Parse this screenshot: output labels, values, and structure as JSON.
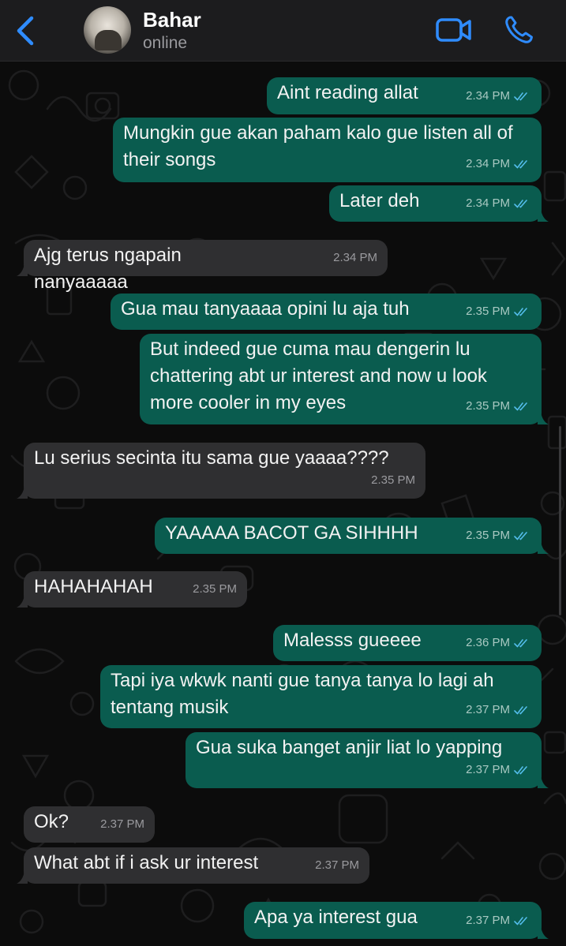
{
  "header": {
    "contact_name": "Bahar",
    "status": "online",
    "icons": {
      "back": "chevron-left-icon",
      "video": "video-camera-icon",
      "call": "phone-icon"
    },
    "accent_color": "#2f8cff"
  },
  "colors": {
    "outgoing_bubble": "#0a5c4f",
    "incoming_bubble": "#2f2f31",
    "read_ticks": "#53bdeb"
  },
  "messages": [
    {
      "direction": "out",
      "text": "Aint reading allat",
      "time": "2.34 PM",
      "read": true
    },
    {
      "direction": "out",
      "text": "Mungkin gue akan paham kalo gue listen all of their songs",
      "time": "2.34 PM",
      "read": true
    },
    {
      "direction": "out",
      "text": "Later deh",
      "time": "2.34 PM",
      "read": true
    },
    {
      "direction": "in",
      "text": "Ajg terus ngapain nanyaaaaa",
      "time": "2.34 PM"
    },
    {
      "direction": "out",
      "text": "Gua mau tanyaaaa opini lu aja tuh",
      "time": "2.35 PM",
      "read": true
    },
    {
      "direction": "out",
      "text": "But indeed gue cuma mau dengerin lu chattering abt ur interest and now u look more cooler in my eyes",
      "time": "2.35 PM",
      "read": true
    },
    {
      "direction": "in",
      "text": "Lu serius secinta itu sama gue yaaaa????",
      "time": "2.35 PM"
    },
    {
      "direction": "out",
      "text": "YAAAAA BACOT GA SIHHHH",
      "time": "2.35 PM",
      "read": true
    },
    {
      "direction": "in",
      "text": "HAHAHAHAH",
      "time": "2.35 PM"
    },
    {
      "direction": "out",
      "text": "Malesss gueeee",
      "time": "2.36 PM",
      "read": true
    },
    {
      "direction": "out",
      "text": "Tapi iya wkwk nanti gue tanya tanya lo lagi ah tentang musik",
      "time": "2.37 PM",
      "read": true
    },
    {
      "direction": "out",
      "text": "Gua suka banget anjir liat lo yapping",
      "time": "2.37 PM",
      "read": true
    },
    {
      "direction": "in",
      "text": "Ok?",
      "time": "2.37 PM"
    },
    {
      "direction": "in",
      "text": "What abt if i ask ur interest",
      "time": "2.37 PM"
    },
    {
      "direction": "out",
      "text": "Apa ya interest gua",
      "time": "2.37 PM",
      "read": true
    }
  ]
}
